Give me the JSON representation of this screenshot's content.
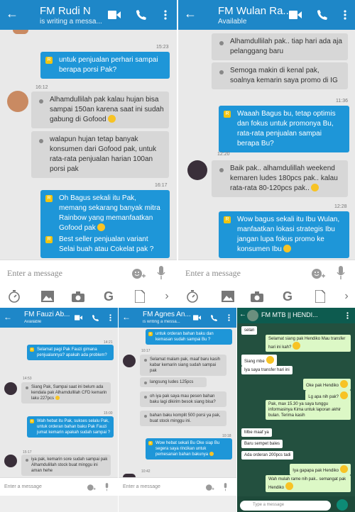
{
  "panels": {
    "rudi": {
      "title": "FM Rudi N",
      "status": "is writing a messa...",
      "input_placeholder": "Enter a message",
      "messages": [
        {
          "time": "15:23",
          "text": "untuk penjualan perhari sampai berapa porsi Pak?"
        },
        {
          "time": "16:12",
          "text": "Alhamdullilah pak kalau hujan bisa sampai 150an karena saat ini sudah gabung di Gofood"
        },
        {
          "text": "walapun hujan tetap banyak konsumen dari Gofood pak, untuk rata-rata penjualan harian 100an porsi pak"
        },
        {
          "time": "16:17",
          "text": "Oh Bagus sekali itu Pak, memang sekarang banyak mitra Rainbow yang memanfaatkan Gofood pak"
        },
        {
          "text": "Best seller penjualan variant Selai buah atau Cokelat pak ?"
        }
      ]
    },
    "wulan": {
      "title": "FM Wulan Ra...",
      "status": "Available",
      "input_placeholder": "Enter a message",
      "messages": [
        {
          "text": "Alhamdullilah pak.. tiap hari ada aja pelanggang baru"
        },
        {
          "text": "Semoga makin di kenal pak, soalnya kemarin saya promo di IG"
        },
        {
          "time": "11:36",
          "text": "Waaah Bagus bu, tetap optimis dan fokus untuk promonya Bu, rata-rata penjualan sampai berapa Bu?"
        },
        {
          "time": "12:20",
          "text": "Baik pak.. alhamdulillah weekend kemaren ludes 180pcs pak.. kalau rata-rata 80-120pcs pak.."
        },
        {
          "time": "12:28",
          "text": "Wow bagus sekali itu Ibu Wulan, manfaatkan lokasi strategis Ibu jangan lupa fokus promo ke konsumen Ibu"
        }
      ]
    },
    "fauzi": {
      "title": "FM Fauzi Ab...",
      "status": "Available",
      "input_placeholder": "Enter a message",
      "messages": [
        {
          "time": "14:21",
          "text": "Selamat pagi Pak Fauzi gimana penjualannya? apakah ada problem?"
        },
        {
          "time": "14:53",
          "text": "Siang Pak, Sampai saat ini belum ada kendala pak Alhamdullilah CFD kemarin laku 227pcs"
        },
        {
          "time": "15:00",
          "text": "Wah hebat itu Pak, sukses selalu Pak, untuk orderan bahan baku Pak Fauzi jumat kemarin apakah sudah sampai ?"
        },
        {
          "time": "15:17",
          "text": "iya pak, kemarin sore sudah sampai pak Alhamdulillah stock buat minggu ini aman hehe"
        }
      ]
    },
    "agnes": {
      "title": "FM Agnes An...",
      "status": "is writing a messa...",
      "input_placeholder": "Enter a message",
      "messages": [
        {
          "text": "untuk orderan bahan baku dan kemasan sudah sampai Bu ?"
        },
        {
          "time": "10:17",
          "text": "Selamat malam pak, maaf baru kasih kabar kemarin siang sudah sampai pak"
        },
        {
          "text": "langsung ludes 125pcs"
        },
        {
          "text": "oh iya pak saya mau pesen bahan baku lagi dikirim besok siang bisa?"
        },
        {
          "text": "bahan baku komplit 500 porsi ya pak, buat stock minggu ini."
        },
        {
          "time": "10:18",
          "text": "Wow hebat sekali Bu Oke siap Bu segera saya rincikan untuk pemesanan bahan bakunya"
        },
        {
          "time": "10:42"
        }
      ]
    },
    "mtb": {
      "title": "FM MTB || HENDI...",
      "input_placeholder": "Type a message",
      "messages": [
        {
          "dir": "in",
          "text": "selan"
        },
        {
          "dir": "out",
          "text": "Selamat siang pak Hendiko Mau transfer hari ini kah?"
        },
        {
          "dir": "in",
          "text": "Siang mbe"
        },
        {
          "dir": "in",
          "text": "Iya saya transfer hari ini"
        },
        {
          "dir": "out",
          "text": "Oke pak Hendiko"
        },
        {
          "dir": "out",
          "text": "Lg apa nih pak?"
        },
        {
          "dir": "out",
          "text": "Pak, max 15.30 ya saya tunggu informasinya Kima untuk laporan akhir bulan. Terima kasih"
        },
        {
          "dir": "in",
          "text": "Mbe maaf ya"
        },
        {
          "dir": "in",
          "text": "Baru sempet bales"
        },
        {
          "dir": "in",
          "text": "Ada orderan 200pcs tadi"
        },
        {
          "dir": "out",
          "text": "Iya gapapa pak Hendiko"
        },
        {
          "dir": "out",
          "text": "Wah mulah rame nih pak.. semangat pak Hendiko"
        }
      ]
    }
  },
  "icons": [
    "back-arrow-icon",
    "video-icon",
    "phone-icon",
    "menu-dots-icon",
    "emoji-icon",
    "mic-icon",
    "timer-icon",
    "image-icon",
    "camera-icon",
    "google-icon",
    "document-icon",
    "chevron-right-icon"
  ],
  "colors": {
    "header": "#1e87c8",
    "outgoing_bubble": "#1e96d8",
    "incoming_bubble": "#d7d7d7",
    "wa_header": "#0d5b4f",
    "wa_out": "#dcf8c6"
  }
}
